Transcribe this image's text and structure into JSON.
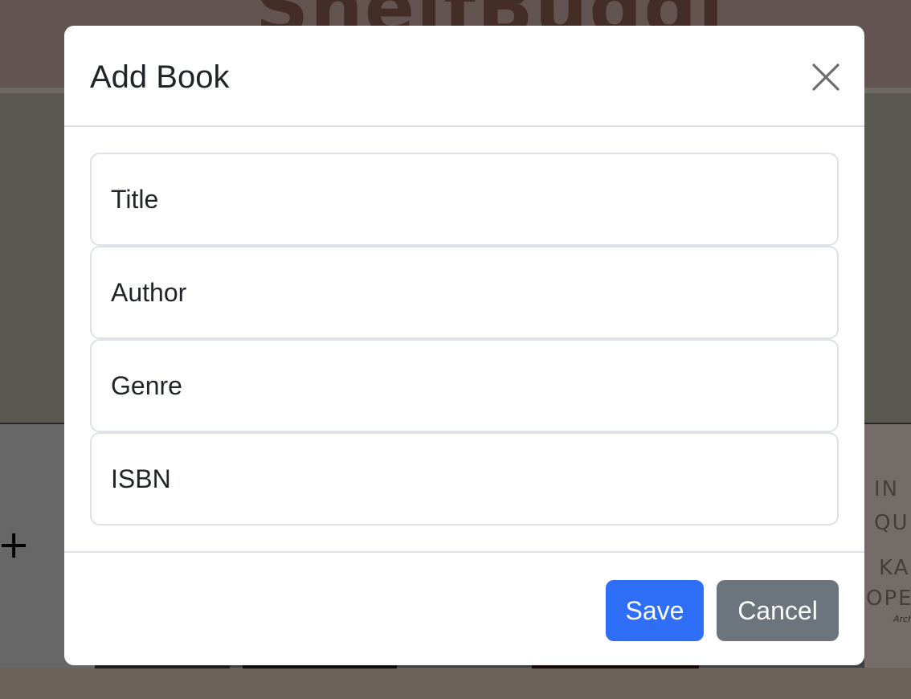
{
  "background": {
    "logo_text": "ShelfBuddi",
    "add_tile_symbol": "+",
    "cover_text": [
      "IN",
      "QU",
      "KA",
      "OPE",
      "Archer"
    ]
  },
  "modal": {
    "title": "Add Book",
    "close_icon": "close-icon",
    "fields": [
      {
        "label": "Title"
      },
      {
        "label": "Author"
      },
      {
        "label": "Genre"
      },
      {
        "label": "ISBN"
      }
    ],
    "footer": {
      "save_label": "Save",
      "cancel_label": "Cancel"
    }
  },
  "colors": {
    "primary": "#2f6ff7",
    "secondary": "#6c757d",
    "text": "#212529",
    "border": "#dee2e6"
  }
}
